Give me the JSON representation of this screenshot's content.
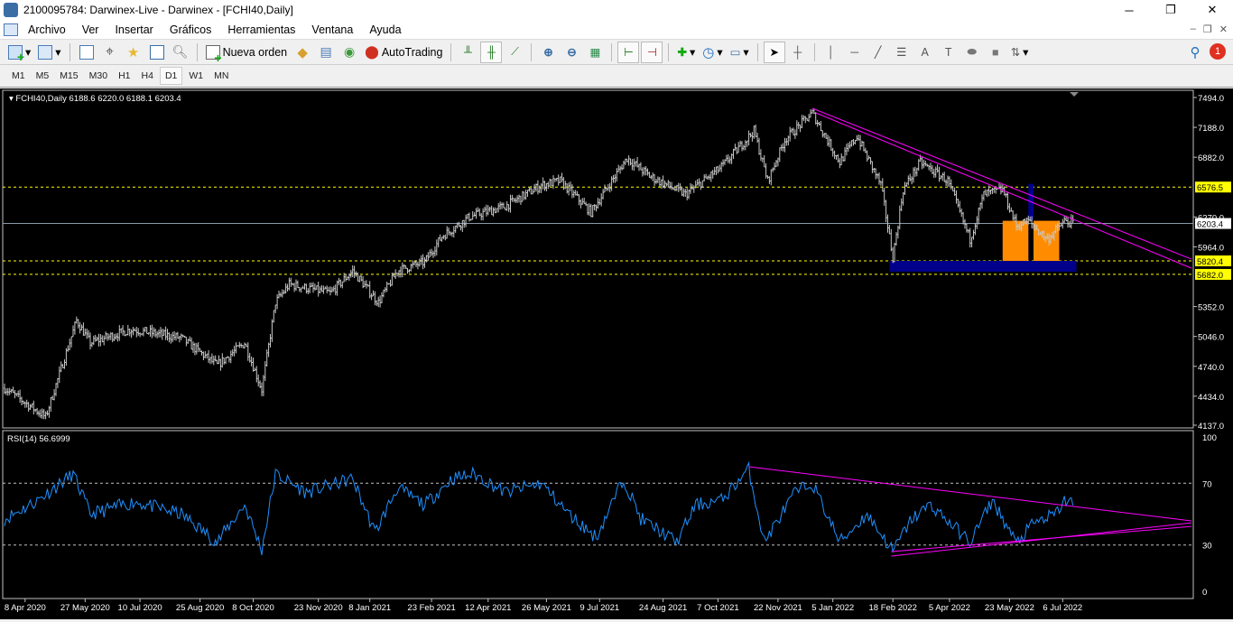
{
  "window": {
    "title": "2100095784: Darwinex-Live - Darwinex - [FCHI40,Daily]",
    "minimize": "─",
    "maximize": "❐",
    "close": "✕"
  },
  "menu": [
    "Archivo",
    "Ver",
    "Insertar",
    "Gráficos",
    "Herramientas",
    "Ventana",
    "Ayuda"
  ],
  "toolbar": {
    "new_order": "Nueva orden",
    "autotrading": "AutoTrading",
    "notifications": "1"
  },
  "timeframes": [
    "M1",
    "M5",
    "M15",
    "M30",
    "H1",
    "H4",
    "D1",
    "W1",
    "MN"
  ],
  "active_timeframe": "D1",
  "colors": {
    "bg": "#000000",
    "bars": "#c8c8c8",
    "trend": "#ff00ff",
    "level": "#ffff00",
    "rect_blue": "#00008b",
    "rect_orange": "#ff8c00",
    "rsi": "#1e90ff"
  },
  "chart_data": [
    {
      "type": "ohlc",
      "title": "FCHI40,Daily",
      "ohlc_label": "6188.6 6220.0 6188.1 6203.4",
      "ylim": [
        4137.0,
        7494.0
      ],
      "y_ticks": [
        "7494.0",
        "7188.0",
        "6882.0",
        "6270.0",
        "5964.0",
        "5352.0",
        "5046.0",
        "4740.0",
        "4434.0",
        "4137.0"
      ],
      "x_labels": [
        {
          "label": "8 Apr 2020",
          "bar": 12
        },
        {
          "label": "27 May 2020",
          "bar": 47
        },
        {
          "label": "10 Jul 2020",
          "bar": 79
        },
        {
          "label": "25 Aug 2020",
          "bar": 114
        },
        {
          "label": "8 Oct 2020",
          "bar": 145
        },
        {
          "label": "23 Nov 2020",
          "bar": 183
        },
        {
          "label": "8 Jan 2021",
          "bar": 213
        },
        {
          "label": "23 Feb 2021",
          "bar": 249
        },
        {
          "label": "12 Apr 2021",
          "bar": 282
        },
        {
          "label": "26 May 2021",
          "bar": 316
        },
        {
          "label": "9 Jul 2021",
          "bar": 347
        },
        {
          "label": "24 Aug 2021",
          "bar": 384
        },
        {
          "label": "7 Oct 2021",
          "bar": 416
        },
        {
          "label": "22 Nov 2021",
          "bar": 451
        },
        {
          "label": "5 Jan 2022",
          "bar": 483
        },
        {
          "label": "18 Feb 2022",
          "bar": 518
        },
        {
          "label": "5 Apr 2022",
          "bar": 551
        },
        {
          "label": "23 May 2022",
          "bar": 586
        },
        {
          "label": "6 Jul 2022",
          "bar": 617
        }
      ],
      "close_keypoints": [
        [
          0,
          4517
        ],
        [
          24,
          4220
        ],
        [
          42,
          5210
        ],
        [
          50,
          4980
        ],
        [
          74,
          5120
        ],
        [
          103,
          5030
        ],
        [
          124,
          4750
        ],
        [
          140,
          4980
        ],
        [
          150,
          4500
        ],
        [
          158,
          5395
        ],
        [
          166,
          5580
        ],
        [
          190,
          5490
        ],
        [
          203,
          5718
        ],
        [
          218,
          5395
        ],
        [
          229,
          5718
        ],
        [
          245,
          5810
        ],
        [
          255,
          6070
        ],
        [
          271,
          6270
        ],
        [
          292,
          6380
        ],
        [
          313,
          6595
        ],
        [
          324,
          6640
        ],
        [
          342,
          6320
        ],
        [
          363,
          6874
        ],
        [
          376,
          6690
        ],
        [
          397,
          6500
        ],
        [
          418,
          6780
        ],
        [
          437,
          7152
        ],
        [
          445,
          6640
        ],
        [
          455,
          7060
        ],
        [
          471,
          7336
        ],
        [
          487,
          6830
        ],
        [
          497,
          7100
        ],
        [
          511,
          6600
        ],
        [
          518,
          5857
        ],
        [
          524,
          6550
        ],
        [
          534,
          6830
        ],
        [
          550,
          6640
        ],
        [
          563,
          6040
        ],
        [
          571,
          6500
        ],
        [
          582,
          6550
        ],
        [
          590,
          6180
        ],
        [
          597,
          6230
        ],
        [
          608,
          6040
        ],
        [
          618,
          6227
        ],
        [
          623,
          6203.4
        ]
      ],
      "levels": [
        {
          "price": 6576.5,
          "label": "6576.5",
          "style": "dashed-yellow"
        },
        {
          "price": 6203.4,
          "label": "6203.4",
          "style": "solid-gray"
        },
        {
          "price": 5820.4,
          "label": "5820.4",
          "style": "dashed-yellow"
        },
        {
          "price": 5682.0,
          "label": "5682.0",
          "style": "dashed-yellow"
        }
      ],
      "trendlines": [
        [
          [
            471,
            7383
          ],
          [
            692,
            5839
          ]
        ],
        [
          [
            473,
            7337
          ],
          [
            692,
            5746
          ]
        ]
      ],
      "rectangles": [
        {
          "bars": [
            516,
            625
          ],
          "prices": [
            5820,
            5710
          ],
          "color": "blue"
        },
        {
          "bars": [
            582,
            597
          ],
          "prices": [
            6231,
            5820
          ],
          "color": "orange"
        },
        {
          "bars": [
            600,
            615
          ],
          "prices": [
            6231,
            5820
          ],
          "color": "orange"
        },
        {
          "bars": [
            597,
            600
          ],
          "prices": [
            6610,
            6240
          ],
          "color": "blue"
        }
      ]
    },
    {
      "type": "line",
      "title": "RSI(14) 56.6999",
      "ylim": [
        0,
        100
      ],
      "y_ticks": [
        "100",
        "70",
        "30",
        "0"
      ],
      "levels": [
        70,
        30
      ],
      "keypoints": [
        [
          0,
          46.8
        ],
        [
          18,
          58
        ],
        [
          40,
          76
        ],
        [
          50,
          50
        ],
        [
          76,
          58
        ],
        [
          103,
          50
        ],
        [
          124,
          32
        ],
        [
          140,
          56
        ],
        [
          150,
          27
        ],
        [
          158,
          76
        ],
        [
          176,
          64
        ],
        [
          203,
          73
        ],
        [
          216,
          38
        ],
        [
          229,
          67
        ],
        [
          245,
          56
        ],
        [
          261,
          73
        ],
        [
          274,
          76
        ],
        [
          292,
          64
        ],
        [
          313,
          70
        ],
        [
          329,
          50
        ],
        [
          345,
          35
        ],
        [
          361,
          73
        ],
        [
          371,
          47
        ],
        [
          392,
          32
        ],
        [
          403,
          56
        ],
        [
          418,
          59
        ],
        [
          434,
          79
        ],
        [
          443,
          32
        ],
        [
          461,
          64
        ],
        [
          471,
          70
        ],
        [
          487,
          32
        ],
        [
          503,
          50
        ],
        [
          518,
          26
        ],
        [
          529,
          47
        ],
        [
          540,
          56
        ],
        [
          563,
          32
        ],
        [
          576,
          59
        ],
        [
          590,
          31
        ],
        [
          600,
          44
        ],
        [
          613,
          50
        ],
        [
          618,
          59
        ],
        [
          623,
          56.7
        ]
      ],
      "trendlines": [
        [
          [
            434,
            80.7
          ],
          [
            692,
            45.6
          ]
        ],
        [
          [
            517,
            22.8
          ],
          [
            692,
            44.4
          ]
        ],
        [
          [
            517,
            25.7
          ],
          [
            692,
            42
          ]
        ]
      ]
    }
  ]
}
